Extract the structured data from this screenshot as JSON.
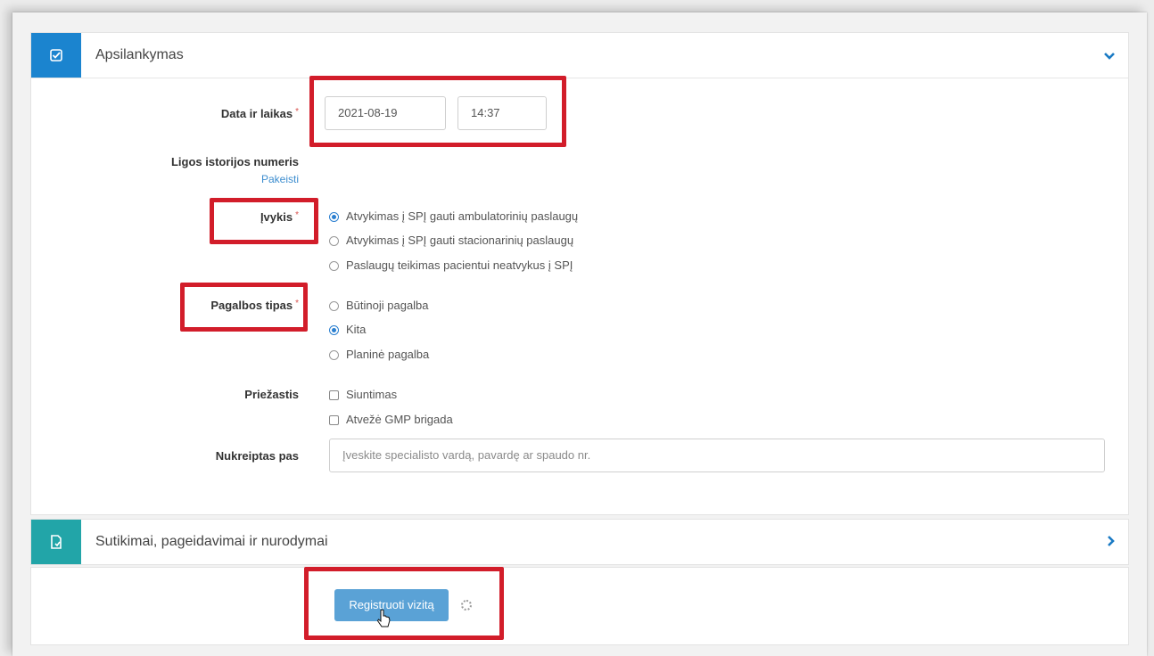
{
  "visit_panel": {
    "title": "Apsilankymas",
    "icon": "edit-check-icon",
    "collapse_icon": "chevron-down-icon",
    "date_time_label": "Data ir laikas",
    "date_value": "2021-08-19",
    "time_value": "14:37",
    "history_label": "Ligos istorijos numeris",
    "history_change_link": "Pakeisti",
    "event_label": "Įvykis",
    "event_options": [
      "Atvykimas į SPĮ gauti ambulatorinių paslaugų",
      "Atvykimas į SPĮ gauti stacionarinių paslaugų",
      "Paslaugų teikimas pacientui neatvykus į SPĮ"
    ],
    "event_selected": 0,
    "help_type_label": "Pagalbos tipas",
    "help_type_options": [
      "Būtinoji pagalba",
      "Kita",
      "Planinė pagalba"
    ],
    "help_type_selected": 1,
    "reason_label": "Priežastis",
    "reason_options": [
      "Siuntimas",
      "Atvežė GMP brigada"
    ],
    "referred_label": "Nukreiptas pas",
    "referred_placeholder": "Įveskite specialisto vardą, pavardę ar spaudo nr."
  },
  "consents_panel": {
    "title": "Sutikimai, pageidavimai ir nurodymai",
    "icon": "document-icon",
    "expand_icon": "chevron-right-icon"
  },
  "footer": {
    "register_button": "Registruoti vizitą"
  },
  "colors": {
    "header_icon_blue": "#1b84cf",
    "header_icon_teal": "#22a5a8",
    "highlight_red": "#d21d2a",
    "button_blue": "#5aa2d6"
  }
}
